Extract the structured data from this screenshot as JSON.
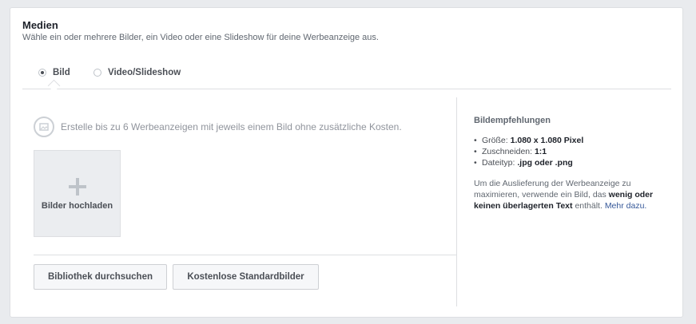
{
  "section": {
    "title": "Medien",
    "subtitle": "Wähle ein oder mehrere Bilder, ein Video oder eine Slideshow für deine Werbeanzeige aus."
  },
  "tabs": [
    {
      "label": "Bild",
      "selected": true
    },
    {
      "label": "Video/Slideshow",
      "selected": false
    }
  ],
  "main": {
    "info": "Erstelle bis zu 6 Werbeanzeigen mit jeweils einem Bild ohne zusätzliche Kosten.",
    "upload_label": "Bilder hochladen",
    "buttons": {
      "library": "Bibliothek durchsuchen",
      "stock": "Kostenlose Standardbilder"
    }
  },
  "recommendations": {
    "title": "Bildempfehlungen",
    "items": [
      {
        "label": "Größe:",
        "value": "1.080 x 1.080 Pixel"
      },
      {
        "label": "Zuschneiden:",
        "value": "1:1"
      },
      {
        "label": "Dateityp:",
        "value": ".jpg oder .png"
      }
    ],
    "desc_pre": "Um die Auslieferung der Werbeanzeige zu maximieren, verwende ein Bild, das",
    "desc_bold": "wenig oder keinen überlagerten Text",
    "desc_post": "enthält.",
    "link": "Mehr dazu."
  },
  "colors": {
    "background": "#e9ebee",
    "link": "#365899",
    "text": "#1d2129"
  }
}
